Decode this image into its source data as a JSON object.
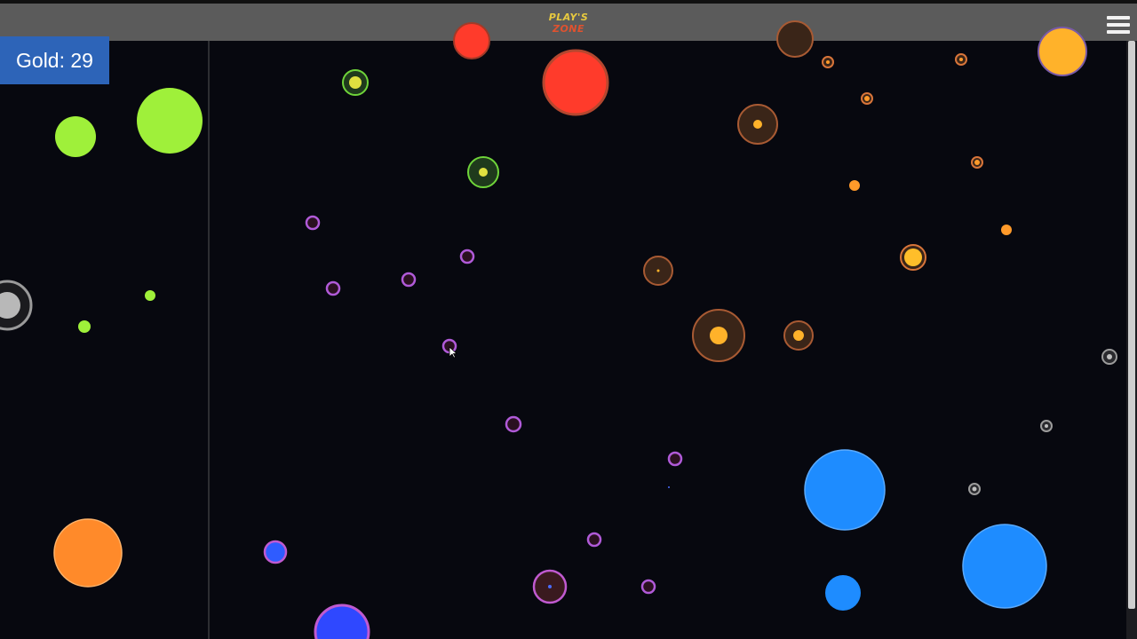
{
  "header": {
    "logo_line1": "PLAY'S",
    "logo_line2": "ZONE",
    "menu_icon": "hamburger-menu-icon"
  },
  "hud": {
    "gold_label": "Gold: 29"
  },
  "colors": {
    "background": "#07080f",
    "topbar": "#5b5b5b",
    "gold_badge": "#2d64b8",
    "green": "#9ff03a",
    "red": "#ff3b2b",
    "orange": "#ff8a2a",
    "yellow_orange": "#ffb22a",
    "blue": "#1e8cff",
    "purple_ring": "#a45bd8",
    "brown_ring": "#a85a33"
  }
}
